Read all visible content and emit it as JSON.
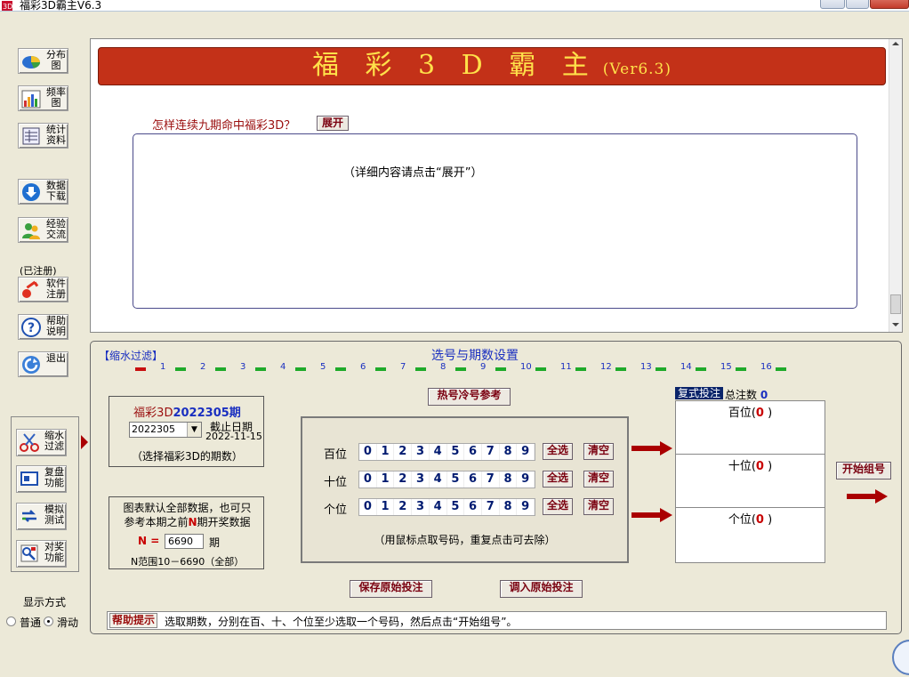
{
  "window": {
    "title": "福彩3D霸主V6.3"
  },
  "sidebar": {
    "register_status": "(已注册)",
    "items": [
      {
        "label": "分布\n图",
        "icon": "pie-chart-icon"
      },
      {
        "label": "频率\n图",
        "icon": "bar-chart-icon"
      },
      {
        "label": "统计\n资料",
        "icon": "statistics-icon"
      },
      {
        "label": "数据\n下载",
        "icon": "download-icon"
      },
      {
        "label": "经验\n交流",
        "icon": "users-icon"
      },
      {
        "label": "软件\n注册",
        "icon": "key-icon"
      },
      {
        "label": "帮助\n说明",
        "icon": "help-icon"
      },
      {
        "label": "退出",
        "icon": "exit-icon"
      }
    ],
    "tools": [
      {
        "label": "缩水\n过滤",
        "icon": "scissors-icon"
      },
      {
        "label": "复盘\n功能",
        "icon": "replay-icon"
      },
      {
        "label": "模拟\n测试",
        "icon": "simulate-icon"
      },
      {
        "label": "对奖\n功能",
        "icon": "check-prize-icon"
      }
    ],
    "display_mode": {
      "label": "显示方式",
      "options": [
        "普通",
        "滑动"
      ],
      "selected": "滑动"
    }
  },
  "banner": {
    "title": "福 彩 3 D 霸 主",
    "version": "(Ver6.3)"
  },
  "question": {
    "text": "怎样连续九期命中福彩3D？",
    "button": "展开"
  },
  "detail": {
    "placeholder": "（详细内容请点击“展开”）"
  },
  "filter_panel": {
    "tag": "【缩水过滤】",
    "title": "选号与期数设置",
    "ruler_numbers": [
      "1",
      "2",
      "3",
      "4",
      "5",
      "6",
      "7",
      "8",
      "9",
      "10",
      "11",
      "12",
      "13",
      "14",
      "15",
      "16"
    ],
    "period": {
      "label_prefix": "福彩3D",
      "current_period": "2022305",
      "label_suffix": "期",
      "select_value": "2022305",
      "deadline_label": "截止日期",
      "deadline_date": "2022-11-15",
      "hint": "（选择福彩3D的期数）"
    },
    "n_setting": {
      "desc_line1": "图表默认全部数据，也可只",
      "desc_line2_a": "参考本期之前",
      "desc_line2_n": "N",
      "desc_line2_b": "期开奖数据",
      "n_label": "N =",
      "n_value": "6690",
      "unit": "期",
      "range": "N范围10－6690（全部）"
    },
    "hot_cold_button": "热号冷号参考",
    "digit_rows": [
      {
        "label": "百位",
        "digits": [
          "0",
          "1",
          "2",
          "3",
          "4",
          "5",
          "6",
          "7",
          "8",
          "9"
        ],
        "select_all": "全选",
        "clear": "清空"
      },
      {
        "label": "十位",
        "digits": [
          "0",
          "1",
          "2",
          "3",
          "4",
          "5",
          "6",
          "7",
          "8",
          "9"
        ],
        "select_all": "全选",
        "clear": "清空"
      },
      {
        "label": "个位",
        "digits": [
          "0",
          "1",
          "2",
          "3",
          "4",
          "5",
          "6",
          "7",
          "8",
          "9"
        ],
        "select_all": "全选",
        "clear": "清空"
      }
    ],
    "digit_hint": "（用鼠标点取号码，重复点击可去除）",
    "save_button": "保存原始投注",
    "load_button": "调入原始投注",
    "bet": {
      "tag": "复式投注",
      "total_label": "总注数",
      "total_value": "0",
      "rows": [
        {
          "label": "百位",
          "count": "0"
        },
        {
          "label": "十位",
          "count": "0"
        },
        {
          "label": "个位",
          "count": "0"
        }
      ]
    },
    "start_button": "开始组号",
    "help": {
      "tag": "帮助提示",
      "text": "选取期数，分别在百、十、个位至少选取一个号码，然后点击“开始组号”。"
    }
  },
  "colors": {
    "banner_bg": "#c33118",
    "banner_text": "#ffe14a",
    "accent_blue": "#1a2fc0",
    "accent_red": "#9a0e0e",
    "ruler_green": "#1faa2a"
  }
}
